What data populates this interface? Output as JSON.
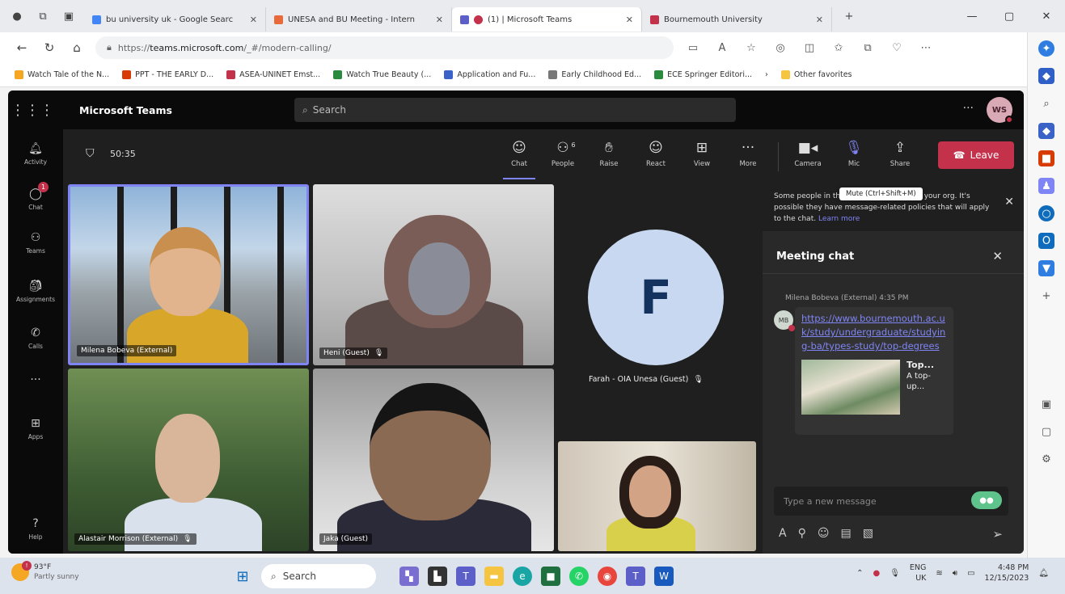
{
  "browser": {
    "tabs": [
      {
        "title": "bu university uk - Google Searc",
        "color": "#4285f4"
      },
      {
        "title": "UNESA and BU Meeting - Intern",
        "color": "#e86a3a"
      },
      {
        "title": "(1) | Microsoft Teams",
        "color": "#5b5fc7"
      },
      {
        "title": "Bournemouth University",
        "color": "#c4314b"
      }
    ],
    "url_prefix": "https://",
    "url_host": "teams.microsoft.com",
    "url_path": "/_#/modern-calling/",
    "bookmarks": [
      {
        "label": "Watch Tale of the N...",
        "color": "#f5a623"
      },
      {
        "label": "PPT - THE EARLY D...",
        "color": "#d83b01"
      },
      {
        "label": "ASEA-UNINET Emst...",
        "color": "#c4314b"
      },
      {
        "label": "Watch True Beauty (...",
        "color": "#2b8a3e"
      },
      {
        "label": "Application and Fu...",
        "color": "#3a62c7"
      },
      {
        "label": "Early Childhood Ed...",
        "color": "#777777"
      },
      {
        "label": "ECE Springer Editori...",
        "color": "#2b8a3e"
      }
    ],
    "other_favorites": "Other favorites"
  },
  "teams": {
    "app_title": "Microsoft Teams",
    "search_placeholder": "Search",
    "avatar_initials": "WS",
    "rail": [
      {
        "label": "Activity",
        "icon": "bell-icon"
      },
      {
        "label": "Chat",
        "icon": "chat-icon",
        "badge": "1"
      },
      {
        "label": "Teams",
        "icon": "teams-icon"
      },
      {
        "label": "Assignments",
        "icon": "assignments-icon"
      },
      {
        "label": "Calls",
        "icon": "phone-icon"
      },
      {
        "label": "Apps",
        "icon": "apps-icon"
      },
      {
        "label": "Help",
        "icon": "help-icon"
      }
    ],
    "meeting": {
      "timer": "50:35",
      "controls": [
        {
          "label": "Chat",
          "icon": "chat-icon"
        },
        {
          "label": "People",
          "icon": "people-icon",
          "count": "6"
        },
        {
          "label": "Raise",
          "icon": "hand-icon"
        },
        {
          "label": "React",
          "icon": "smile-icon"
        },
        {
          "label": "View",
          "icon": "grid-icon"
        },
        {
          "label": "More",
          "icon": "more-icon"
        },
        {
          "label": "Camera",
          "icon": "camera-icon"
        },
        {
          "label": "Mic",
          "icon": "mic-icon"
        },
        {
          "label": "Share",
          "icon": "share-icon"
        }
      ],
      "leave_label": "Leave",
      "participants": [
        {
          "name": "Milena Bobeva (External)"
        },
        {
          "name": "Heni (Guest)"
        },
        {
          "name": "Farah - OIA Unesa (Guest)",
          "initial": "F"
        },
        {
          "name": "Alastair Morrison (External)"
        },
        {
          "name": "Jaka (Guest)"
        }
      ]
    },
    "chat": {
      "notice_text": "Some people in this meeting are outside your org. It's possible they have message-related policies that will apply to the chat.",
      "notice_link": "Learn more",
      "tooltip": "Mute (Ctrl+Shift+M)",
      "title": "Meeting chat",
      "sender_meta": "Milena Bobeva (External)  4:35 PM",
      "sender_initials": "MB",
      "link": "https://www.bournemouth.ac.uk/study/undergraduate/studying-ba/types-study/top-degrees",
      "preview_title": "Top...",
      "preview_text": "A top-up...",
      "compose_placeholder": "Type a new message"
    }
  },
  "taskbar": {
    "temp": "93°F",
    "weather": "Partly sunny",
    "search": "Search",
    "lang_top": "ENG",
    "lang_bottom": "UK",
    "time": "4:48 PM",
    "date": "12/15/2023"
  }
}
